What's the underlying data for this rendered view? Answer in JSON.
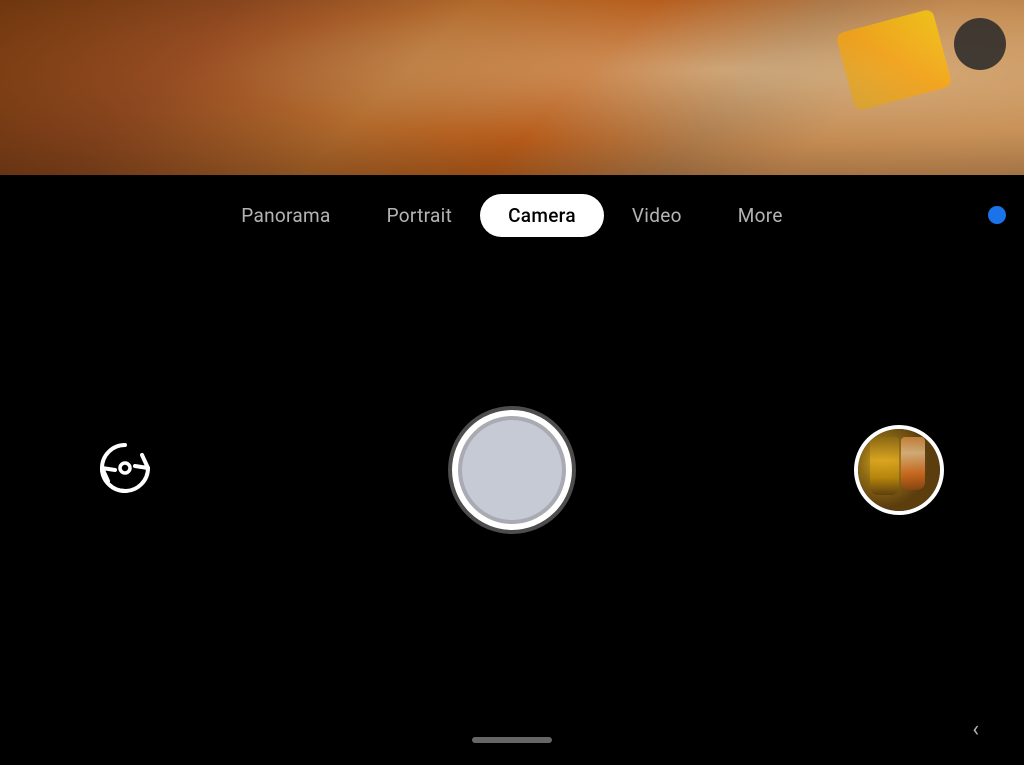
{
  "viewfinder": {
    "description": "Camera viewfinder showing blurred scene"
  },
  "lens_button": {
    "label": "Google Lens",
    "icon": "lens-icon"
  },
  "modes": {
    "items": [
      {
        "id": "panorama",
        "label": "Panorama",
        "active": false
      },
      {
        "id": "portrait",
        "label": "Portrait",
        "active": false
      },
      {
        "id": "camera",
        "label": "Camera",
        "active": true
      },
      {
        "id": "video",
        "label": "Video",
        "active": false
      },
      {
        "id": "more",
        "label": "More",
        "active": false
      }
    ]
  },
  "controls": {
    "flip_camera_label": "Flip camera",
    "shutter_label": "Take photo",
    "thumbnail_label": "Gallery"
  },
  "bottom": {
    "back_icon": "back-chevron-icon",
    "home_indicator": "Home indicator"
  },
  "colors": {
    "active_mode_bg": "#ffffff",
    "active_mode_text": "#000000",
    "inactive_mode_text": "rgba(255,255,255,0.7)",
    "blue_dot": "#1a73e8",
    "shutter": "rgba(200,205,215,0.9)",
    "background": "#000000"
  }
}
